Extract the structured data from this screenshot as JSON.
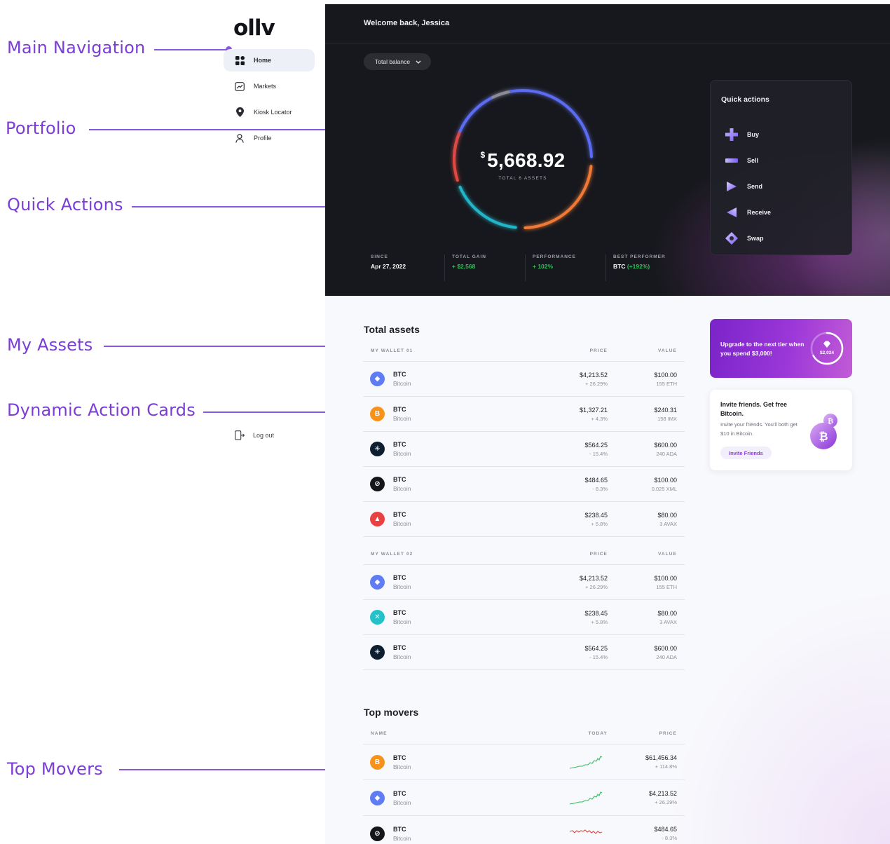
{
  "annotations": [
    {
      "label": "Main Navigation"
    },
    {
      "label": "Portfolio"
    },
    {
      "label": "Quick Actions"
    },
    {
      "label": "My Assets"
    },
    {
      "label": "Dynamic Action Cards"
    },
    {
      "label": "Top Movers"
    }
  ],
  "app": {
    "logo": "ollv"
  },
  "sidebar": {
    "items": [
      {
        "label": "Home",
        "icon": "grid-icon"
      },
      {
        "label": "Markets",
        "icon": "chart-icon"
      },
      {
        "label": "Kiosk Locator",
        "icon": "location-pin-icon"
      },
      {
        "label": "Profile",
        "icon": "user-icon"
      }
    ],
    "logout_label": "Log out"
  },
  "hero": {
    "welcome": "Welcome back, Jessica",
    "balance_selector": "Total balance",
    "total_currency": "$",
    "total_amount": "5,668.92",
    "total_sub": "TOTAL 6 ASSETS",
    "stats": [
      {
        "label": "SINCE",
        "value": "Apr 27, 2022"
      },
      {
        "label": "TOTAL GAIN",
        "value": "+ $2,568"
      },
      {
        "label": "PERFORMANCE",
        "value": "+ 102%"
      },
      {
        "label": "BEST PERFORMER",
        "value": "BTC",
        "extra": "(+192%)"
      }
    ],
    "ring_colors": {
      "blue": "#5b6cf0",
      "orange": "#f07a34",
      "teal": "#20b4c8",
      "red": "#e0493f",
      "grey": "#8a8b93"
    }
  },
  "quick_actions": {
    "title": "Quick actions",
    "items": [
      {
        "label": "Buy",
        "icon": "plus-icon"
      },
      {
        "label": "Sell",
        "icon": "minus-icon"
      },
      {
        "label": "Send",
        "icon": "send-icon"
      },
      {
        "label": "Receive",
        "icon": "receive-icon"
      },
      {
        "label": "Swap",
        "icon": "swap-icon"
      }
    ]
  },
  "assets": {
    "title": "Total assets",
    "wallets": [
      {
        "name": "MY WALLET 01",
        "price_header": "PRICE",
        "value_header": "VALUE",
        "rows": [
          {
            "symbol": "BTC",
            "name": "Bitcoin",
            "price": "$4,213.52",
            "change": "+ 26.29%",
            "dir": "up",
            "value": "$100.00",
            "amount": "155 ETH",
            "coin_color": "#5f7cf2",
            "glyph": "◆"
          },
          {
            "symbol": "BTC",
            "name": "Bitcoin",
            "price": "$1,327.21",
            "change": "+ 4.3%",
            "dir": "up",
            "value": "$240.31",
            "amount": "158 IMX",
            "coin_color": "#f7931a",
            "glyph": "B"
          },
          {
            "symbol": "BTC",
            "name": "Bitcoin",
            "price": "$564.25",
            "change": "- 15.4%",
            "dir": "down",
            "value": "$600.00",
            "amount": "240 ADA",
            "coin_color": "#0d1e30",
            "glyph": "✳"
          },
          {
            "symbol": "BTC",
            "name": "Bitcoin",
            "price": "$484.65",
            "change": "- 8.3%",
            "dir": "down",
            "value": "$100.00",
            "amount": "0.025 XML",
            "coin_color": "#15161a",
            "glyph": "⊘"
          },
          {
            "symbol": "BTC",
            "name": "Bitcoin",
            "price": "$238.45",
            "change": "+ 5.8%",
            "dir": "up",
            "value": "$80.00",
            "amount": "3 AVAX",
            "coin_color": "#e84142",
            "glyph": "▲"
          }
        ]
      },
      {
        "name": "MY WALLET 02",
        "price_header": "PRICE",
        "value_header": "VALUE",
        "rows": [
          {
            "symbol": "BTC",
            "name": "Bitcoin",
            "price": "$4,213.52",
            "change": "+ 26.29%",
            "dir": "up",
            "value": "$100.00",
            "amount": "155 ETH",
            "coin_color": "#5f7cf2",
            "glyph": "◆"
          },
          {
            "symbol": "BTC",
            "name": "Bitcoin",
            "price": "$238.45",
            "change": "+ 5.8%",
            "dir": "up",
            "value": "$80.00",
            "amount": "3 AVAX",
            "coin_color": "#23c2c9",
            "glyph": "✕"
          },
          {
            "symbol": "BTC",
            "name": "Bitcoin",
            "price": "$564.25",
            "change": "- 15.4%",
            "dir": "down",
            "value": "$600.00",
            "amount": "240 ADA",
            "coin_color": "#0d1e30",
            "glyph": "✳"
          }
        ]
      }
    ]
  },
  "cards": {
    "upgrade": {
      "text": "Upgrade to the next tier when you spend $3,000!",
      "amount": "$2,024",
      "progress": 0.67
    },
    "invite": {
      "title": "Invite friends. Get free Bitcoin.",
      "body": "Invite your friends. You'll both get $10 in Bitcoin.",
      "button": "Invite Friends"
    }
  },
  "top_movers": {
    "title": "Top movers",
    "headers": {
      "name": "NAME",
      "today": "TODAY",
      "price": "PRICE"
    },
    "rows": [
      {
        "symbol": "BTC",
        "name": "Bitcoin",
        "price": "$61,456.34",
        "change": "+ 114.8%",
        "dir": "up",
        "coin_color": "#f7931a",
        "glyph": "B"
      },
      {
        "symbol": "BTC",
        "name": "Bitcoin",
        "price": "$4,213.52",
        "change": "+ 26.29%",
        "dir": "up",
        "coin_color": "#5f7cf2",
        "glyph": "◆"
      },
      {
        "symbol": "BTC",
        "name": "Bitcoin",
        "price": "$484.65",
        "change": "- 8.3%",
        "dir": "down",
        "coin_color": "#15161a",
        "glyph": "⊘"
      }
    ]
  }
}
